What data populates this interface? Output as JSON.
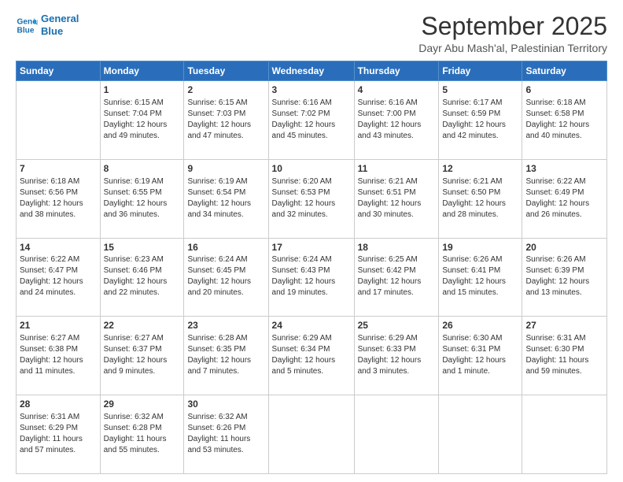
{
  "logo": {
    "line1": "General",
    "line2": "Blue"
  },
  "title": "September 2025",
  "subtitle": "Dayr Abu Mash'al, Palestinian Territory",
  "days_header": [
    "Sunday",
    "Monday",
    "Tuesday",
    "Wednesday",
    "Thursday",
    "Friday",
    "Saturday"
  ],
  "weeks": [
    [
      {
        "day": "",
        "info": ""
      },
      {
        "day": "1",
        "info": "Sunrise: 6:15 AM\nSunset: 7:04 PM\nDaylight: 12 hours\nand 49 minutes."
      },
      {
        "day": "2",
        "info": "Sunrise: 6:15 AM\nSunset: 7:03 PM\nDaylight: 12 hours\nand 47 minutes."
      },
      {
        "day": "3",
        "info": "Sunrise: 6:16 AM\nSunset: 7:02 PM\nDaylight: 12 hours\nand 45 minutes."
      },
      {
        "day": "4",
        "info": "Sunrise: 6:16 AM\nSunset: 7:00 PM\nDaylight: 12 hours\nand 43 minutes."
      },
      {
        "day": "5",
        "info": "Sunrise: 6:17 AM\nSunset: 6:59 PM\nDaylight: 12 hours\nand 42 minutes."
      },
      {
        "day": "6",
        "info": "Sunrise: 6:18 AM\nSunset: 6:58 PM\nDaylight: 12 hours\nand 40 minutes."
      }
    ],
    [
      {
        "day": "7",
        "info": "Sunrise: 6:18 AM\nSunset: 6:56 PM\nDaylight: 12 hours\nand 38 minutes."
      },
      {
        "day": "8",
        "info": "Sunrise: 6:19 AM\nSunset: 6:55 PM\nDaylight: 12 hours\nand 36 minutes."
      },
      {
        "day": "9",
        "info": "Sunrise: 6:19 AM\nSunset: 6:54 PM\nDaylight: 12 hours\nand 34 minutes."
      },
      {
        "day": "10",
        "info": "Sunrise: 6:20 AM\nSunset: 6:53 PM\nDaylight: 12 hours\nand 32 minutes."
      },
      {
        "day": "11",
        "info": "Sunrise: 6:21 AM\nSunset: 6:51 PM\nDaylight: 12 hours\nand 30 minutes."
      },
      {
        "day": "12",
        "info": "Sunrise: 6:21 AM\nSunset: 6:50 PM\nDaylight: 12 hours\nand 28 minutes."
      },
      {
        "day": "13",
        "info": "Sunrise: 6:22 AM\nSunset: 6:49 PM\nDaylight: 12 hours\nand 26 minutes."
      }
    ],
    [
      {
        "day": "14",
        "info": "Sunrise: 6:22 AM\nSunset: 6:47 PM\nDaylight: 12 hours\nand 24 minutes."
      },
      {
        "day": "15",
        "info": "Sunrise: 6:23 AM\nSunset: 6:46 PM\nDaylight: 12 hours\nand 22 minutes."
      },
      {
        "day": "16",
        "info": "Sunrise: 6:24 AM\nSunset: 6:45 PM\nDaylight: 12 hours\nand 20 minutes."
      },
      {
        "day": "17",
        "info": "Sunrise: 6:24 AM\nSunset: 6:43 PM\nDaylight: 12 hours\nand 19 minutes."
      },
      {
        "day": "18",
        "info": "Sunrise: 6:25 AM\nSunset: 6:42 PM\nDaylight: 12 hours\nand 17 minutes."
      },
      {
        "day": "19",
        "info": "Sunrise: 6:26 AM\nSunset: 6:41 PM\nDaylight: 12 hours\nand 15 minutes."
      },
      {
        "day": "20",
        "info": "Sunrise: 6:26 AM\nSunset: 6:39 PM\nDaylight: 12 hours\nand 13 minutes."
      }
    ],
    [
      {
        "day": "21",
        "info": "Sunrise: 6:27 AM\nSunset: 6:38 PM\nDaylight: 12 hours\nand 11 minutes."
      },
      {
        "day": "22",
        "info": "Sunrise: 6:27 AM\nSunset: 6:37 PM\nDaylight: 12 hours\nand 9 minutes."
      },
      {
        "day": "23",
        "info": "Sunrise: 6:28 AM\nSunset: 6:35 PM\nDaylight: 12 hours\nand 7 minutes."
      },
      {
        "day": "24",
        "info": "Sunrise: 6:29 AM\nSunset: 6:34 PM\nDaylight: 12 hours\nand 5 minutes."
      },
      {
        "day": "25",
        "info": "Sunrise: 6:29 AM\nSunset: 6:33 PM\nDaylight: 12 hours\nand 3 minutes."
      },
      {
        "day": "26",
        "info": "Sunrise: 6:30 AM\nSunset: 6:31 PM\nDaylight: 12 hours\nand 1 minute."
      },
      {
        "day": "27",
        "info": "Sunrise: 6:31 AM\nSunset: 6:30 PM\nDaylight: 11 hours\nand 59 minutes."
      }
    ],
    [
      {
        "day": "28",
        "info": "Sunrise: 6:31 AM\nSunset: 6:29 PM\nDaylight: 11 hours\nand 57 minutes."
      },
      {
        "day": "29",
        "info": "Sunrise: 6:32 AM\nSunset: 6:28 PM\nDaylight: 11 hours\nand 55 minutes."
      },
      {
        "day": "30",
        "info": "Sunrise: 6:32 AM\nSunset: 6:26 PM\nDaylight: 11 hours\nand 53 minutes."
      },
      {
        "day": "",
        "info": ""
      },
      {
        "day": "",
        "info": ""
      },
      {
        "day": "",
        "info": ""
      },
      {
        "day": "",
        "info": ""
      }
    ]
  ]
}
